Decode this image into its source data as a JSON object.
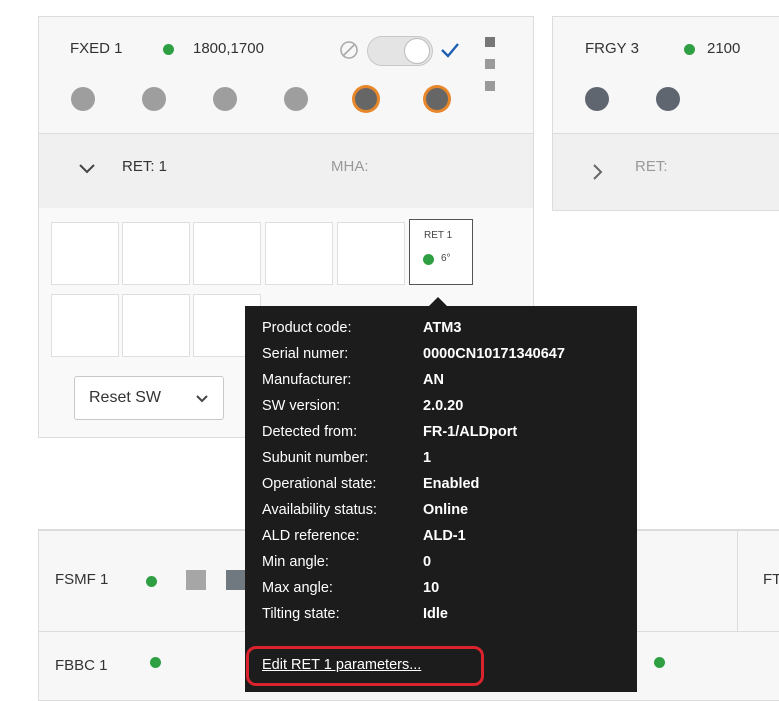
{
  "fxed": {
    "name": "FXED 1",
    "frequencies": "1800,1700",
    "toggle_checked": true
  },
  "frgy": {
    "name": "FRGY 3",
    "frequencies": "2100"
  },
  "ret_section": {
    "ret_label": "RET: 1",
    "mha_label": "MHA:"
  },
  "frgy_ret": {
    "ret_label": "RET:"
  },
  "ret_chip": {
    "title": "RET 1",
    "angle": "6°"
  },
  "reset": {
    "label": "Reset SW"
  },
  "tooltip": {
    "rows": [
      {
        "label": "Product code:",
        "value": "ATM3"
      },
      {
        "label": "Serial numer:",
        "value": "0000CN10171340647"
      },
      {
        "label": "Manufacturer:",
        "value": "AN"
      },
      {
        "label": "SW version:",
        "value": "2.0.20"
      },
      {
        "label": "Detected from:",
        "value": "FR-1/ALDport"
      },
      {
        "label": "Subunit number:",
        "value": "1"
      },
      {
        "label": "Operational state:",
        "value": "Enabled"
      },
      {
        "label": "Availability status:",
        "value": "Online"
      },
      {
        "label": "ALD reference:",
        "value": "ALD-1"
      },
      {
        "label": "Min angle:",
        "value": "0"
      },
      {
        "label": "Max angle:",
        "value": "10"
      },
      {
        "label": "Tilting state:",
        "value": "Idle"
      }
    ],
    "edit_link": "Edit RET 1 parameters..."
  },
  "bottom": {
    "fsmf": "FSMF 1",
    "fbbc": "FBBC 1",
    "ft_partial": "FTI"
  },
  "colors": {
    "status_green": "#2ea043",
    "port_orange": "#e8862a",
    "highlight_red": "#d9232d",
    "tooltip_bg": "#1c1c1c"
  }
}
